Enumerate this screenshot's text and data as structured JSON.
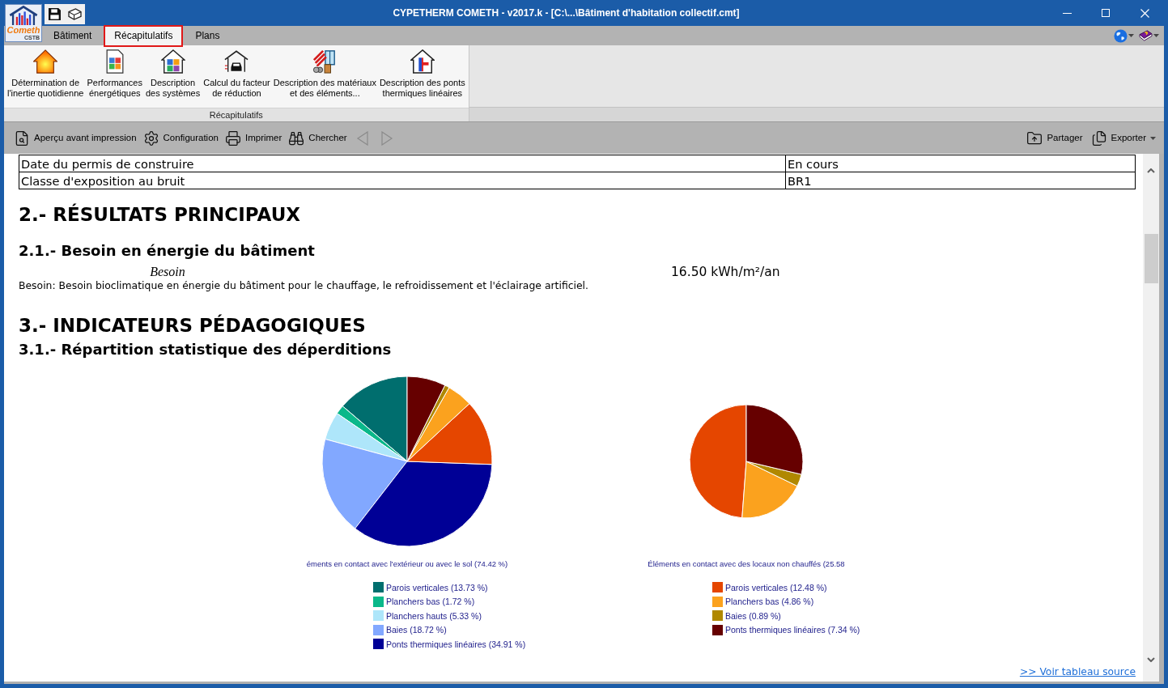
{
  "window": {
    "title": "CYPETHERM COMETH - v2017.k - [C:\\...\\Bâtiment d'habitation collectif.cmt]",
    "logo_text": "Cometh",
    "logo_subtext": "CSTB"
  },
  "tabs": [
    {
      "label": "Bâtiment",
      "selected": false,
      "highlighted": false
    },
    {
      "label": "Récapitulatifs",
      "selected": true,
      "highlighted": true
    },
    {
      "label": "Plans",
      "selected": false,
      "highlighted": false
    }
  ],
  "header_menus": [
    {
      "dropdown": true
    },
    {
      "dropdown": true
    }
  ],
  "ribbon": {
    "group_label": "Récapitulatifs",
    "buttons": [
      {
        "lines": [
          "Détermination de",
          "l'inertie quotidienne"
        ]
      },
      {
        "lines": [
          "Performances",
          "énergétiques"
        ]
      },
      {
        "lines": [
          "Description",
          "des systèmes"
        ]
      },
      {
        "lines": [
          "Calcul du facteur",
          "de réduction"
        ]
      },
      {
        "lines": [
          "Description des matériaux",
          "et des éléments..."
        ]
      },
      {
        "lines": [
          "Description des ponts",
          "thermiques linéaires"
        ]
      }
    ]
  },
  "toolbar": {
    "actions": [
      {
        "label": "Aperçu avant impression"
      },
      {
        "label": "Configuration"
      },
      {
        "label": "Imprimer"
      },
      {
        "label": "Chercher"
      }
    ],
    "navigation": [
      {
        "disabled": true
      },
      {
        "disabled": true
      }
    ],
    "right_actions": [
      {
        "label": "Partager",
        "dropdown": false
      },
      {
        "label": "Exporter",
        "dropdown": true
      }
    ]
  },
  "report": {
    "table_rows": [
      {
        "label": "Date du permis de construire",
        "value": "En cours"
      },
      {
        "label": "Classe d'exposition au bruit",
        "value": "BR1"
      }
    ],
    "results_heading": "2.- RÉSULTATS PRINCIPAUX",
    "energy_heading": "2.1.- Besoin en énergie du bâtiment",
    "indicator": {
      "label": "Besoin",
      "value": "16.50 kWh/m²/an"
    },
    "note": "Besoin: Besoin bioclimatique en énergie du bâtiment pour le chauffage, le refroidissement et l'éclairage artificiel.",
    "indicators_heading": "3.- INDICATEURS PÉDAGOGIQUES",
    "distribution_heading": "3.1.- Répartition statistique des déperditions",
    "charts": [
      {
        "kind": "overall",
        "chart_data": {
          "type": "pie",
          "title": "éments en contact avec l'extérieur ou avec le sol (74.42 %)",
          "values": [
            13.73,
            1.72,
            5.33,
            18.72,
            34.91,
            12.48,
            4.86,
            0.89,
            7.34
          ]
        },
        "legend": [
          {
            "label": "Parois verticales (13.73 %)",
            "color": "#006e6e"
          },
          {
            "label": "Planchers bas (1.72 %)",
            "color": "#0ab88a"
          },
          {
            "label": "Planchers hauts (5.33 %)",
            "color": "#aee6fa"
          },
          {
            "label": "Baies (18.72 %)",
            "color": "#82a8ff"
          },
          {
            "label": "Ponts thermiques linéaires (34.91 %)",
            "color": "#000096"
          }
        ]
      },
      {
        "kind": "subset",
        "chart_data": {
          "type": "pie",
          "title": "Éléments en contact avec des locaux non chauffés (25.58",
          "values": [
            48.81,
            19.01,
            3.48,
            28.7
          ]
        },
        "legend": [
          {
            "label": "Parois verticales (12.48 %)",
            "color": "#e54600"
          },
          {
            "label": "Planchers bas (4.86 %)",
            "color": "#fba21e"
          },
          {
            "label": "Baies (0.89 %)",
            "color": "#b08800"
          },
          {
            "label": "Ponts thermiques linéaires (7.34 %)",
            "color": "#660000"
          }
        ]
      }
    ],
    "source_link": ">> Voir tableau source"
  }
}
